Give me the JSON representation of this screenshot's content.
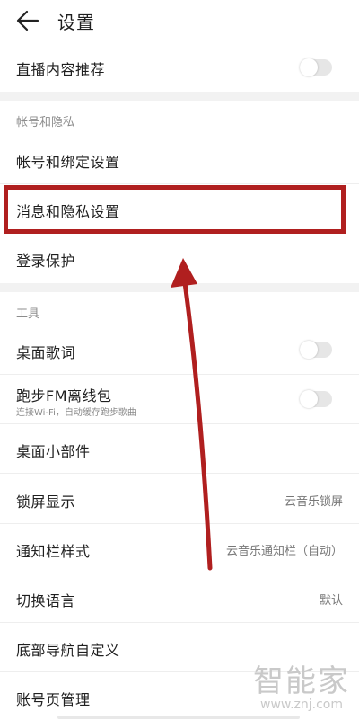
{
  "header": {
    "title": "设置"
  },
  "rows": {
    "live_recommend": {
      "label": "直播内容推荐"
    },
    "account_section": "帐号和隐私",
    "account_binding": {
      "label": "帐号和绑定设置"
    },
    "message_privacy": {
      "label": "消息和隐私设置"
    },
    "login_protect": {
      "label": "登录保护"
    },
    "tools_section": "工具",
    "desktop_lyrics": {
      "label": "桌面歌词"
    },
    "running_fm": {
      "label": "跑步FM离线包",
      "sub": "连接Wi-Fi，自动缓存跑步歌曲"
    },
    "desktop_widget": {
      "label": "桌面小部件"
    },
    "lock_screen": {
      "label": "锁屏显示",
      "value": "云音乐锁屏"
    },
    "notification_style": {
      "label": "通知栏样式",
      "value": "云音乐通知栏（自动）"
    },
    "language": {
      "label": "切换语言",
      "value": "默认"
    },
    "bottom_nav": {
      "label": "底部导航自定义"
    },
    "account_page": {
      "label": "账号页管理"
    }
  },
  "toggles": {
    "live_recommend": false,
    "desktop_lyrics": false,
    "running_fm": false
  },
  "watermark": {
    "text": "智能家",
    "url": "www.znj.com"
  },
  "colors": {
    "highlight": "#b01f1f",
    "toggle_off": "#e6e6e6"
  },
  "icons": {
    "back": "arrow-left-icon"
  }
}
